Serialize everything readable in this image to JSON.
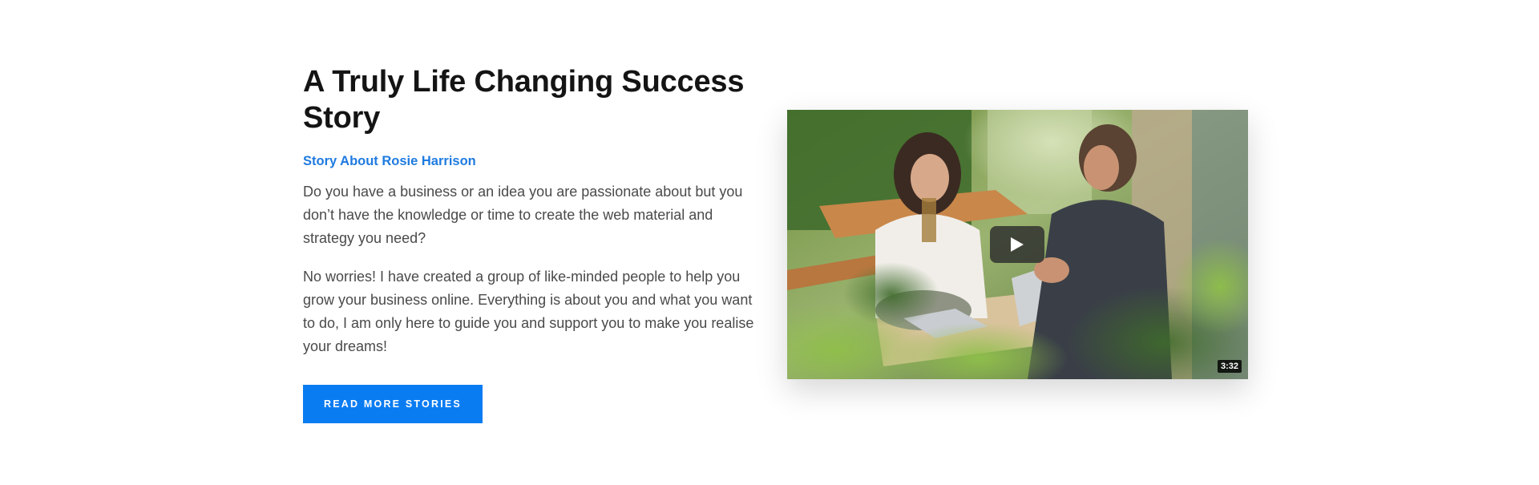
{
  "story": {
    "title": "A Truly Life Changing Success Story",
    "subtitle": "Story About Rosie Harrison",
    "paragraphs": [
      "Do you have a business or an idea you are passionate about but you don’t have the knowledge or time to create the web material and strategy you need?",
      "No worries! I have created a group of like-minded people to help you grow your business online. Everything is about you and what you want to do, I am only here to guide you and support you to make you realise your dreams!"
    ],
    "button_label": "READ MORE STORIES"
  },
  "video": {
    "duration": "3:32",
    "play_icon": "play-icon"
  },
  "colors": {
    "accent": "#0a7cf2",
    "subtitle": "#1f7be0",
    "title": "#141414",
    "body_text": "#4a4a4a"
  }
}
